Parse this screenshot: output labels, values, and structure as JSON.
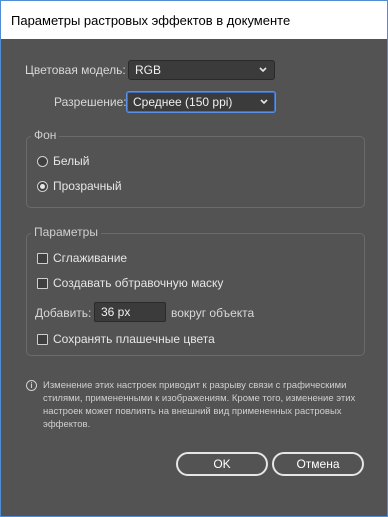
{
  "window": {
    "title": "Параметры растровых эффектов в документе"
  },
  "color_model": {
    "label": "Цветовая модель:",
    "value": "RGB"
  },
  "resolution": {
    "label": "Разрешение:",
    "value": "Среднее (150 ppi)"
  },
  "background": {
    "title": "Фон",
    "options": [
      {
        "label": "Белый",
        "selected": false
      },
      {
        "label": "Прозрачный",
        "selected": true
      }
    ]
  },
  "params": {
    "title": "Параметры",
    "antialias_label": "Сглаживание",
    "clipping_mask_label": "Создавать обтравочную маску",
    "add_label": "Добавить:",
    "add_value": "36 px",
    "around_label": "вокруг объекта",
    "preserve_spot_label": "Сохранять плашечные цвета"
  },
  "note": "Изменение этих настроек приводит к разрыву связи с графическими стилями, примененными к изображениям. Кроме того, изменение этих настроек может повлиять на внешний вид примененных растровых эффектов.",
  "buttons": {
    "ok": "OK",
    "cancel": "Отмена"
  }
}
